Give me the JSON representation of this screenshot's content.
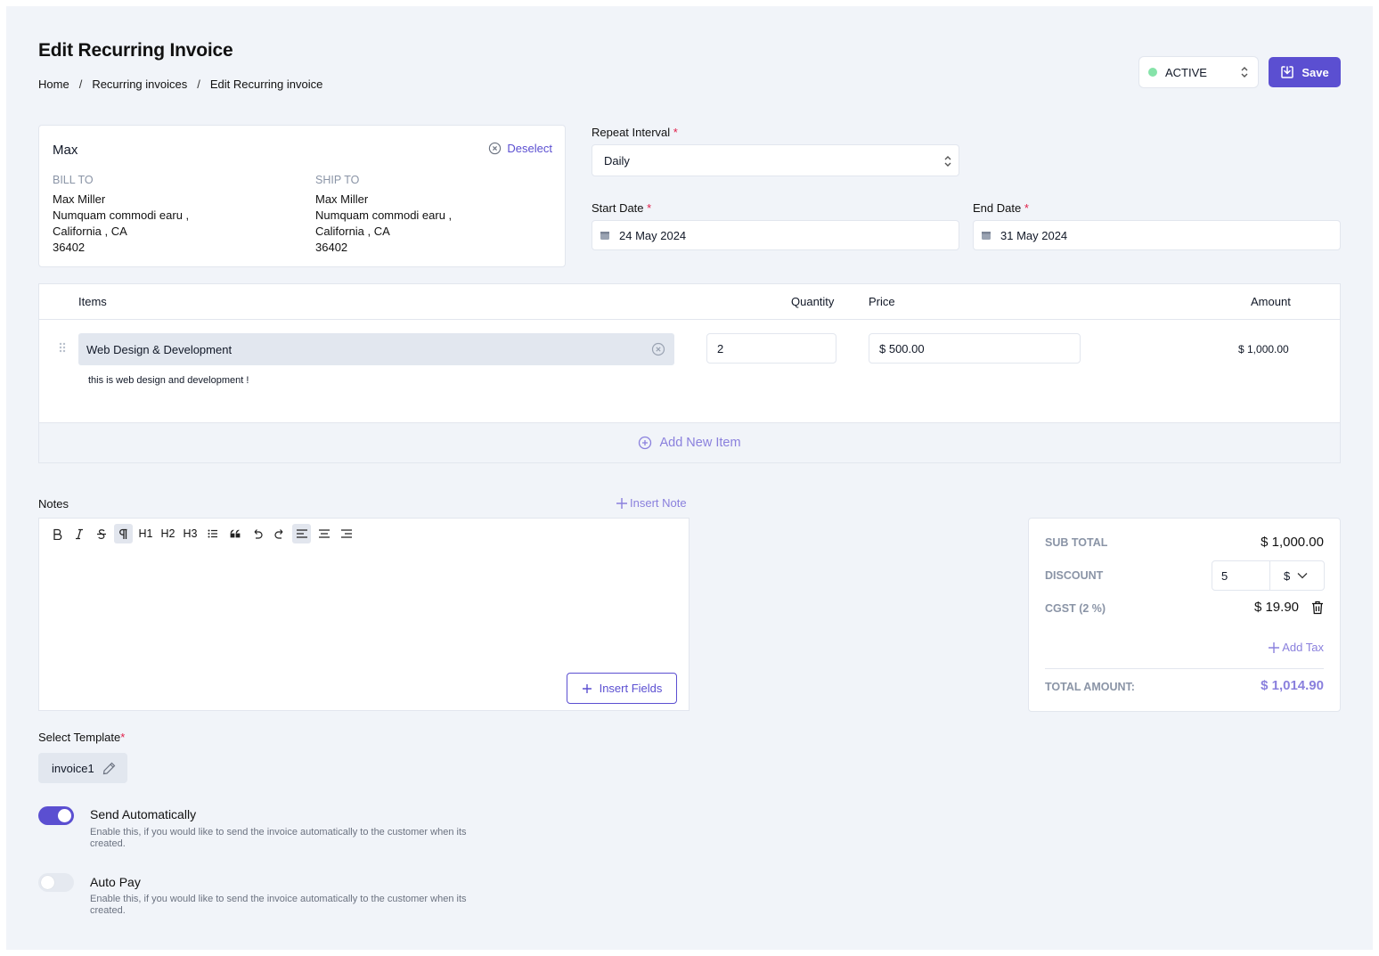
{
  "page": {
    "title": "Edit Recurring Invoice"
  },
  "breadcrumb": [
    "Home",
    "Recurring invoices",
    "Edit Recurring invoice"
  ],
  "status": {
    "value": "ACTIVE",
    "color": "#86e3a9"
  },
  "save_label": "Save",
  "customer": {
    "name": "Max",
    "deselect_label": "Deselect",
    "bill_to": {
      "heading": "BILL TO",
      "lines": [
        "Max Miller",
        "Numquam commodi earu ,",
        "California , CA",
        "36402"
      ]
    },
    "ship_to": {
      "heading": "SHIP TO",
      "lines": [
        "Max Miller",
        "Numquam commodi earu ,",
        "California , CA",
        "36402"
      ]
    }
  },
  "repeat_interval": {
    "label": "Repeat Interval",
    "value": "Daily"
  },
  "start_date": {
    "label": "Start Date",
    "value": "24 May 2024"
  },
  "end_date": {
    "label": "End Date",
    "value": "31 May 2024"
  },
  "items_table": {
    "headers": {
      "items": "Items",
      "quantity": "Quantity",
      "price": "Price",
      "amount": "Amount"
    },
    "rows": [
      {
        "name": "Web Design & Development",
        "description": "this is web design and development !",
        "quantity": "2",
        "price": "$ 500.00",
        "amount": "$ 1,000.00"
      }
    ],
    "add_new_label": "Add New Item"
  },
  "notes": {
    "label": "Notes",
    "insert_note_label": "Insert Note",
    "toolbar": [
      "bold",
      "italic",
      "strikethrough",
      "paragraph",
      "H1",
      "H2",
      "H3",
      "bullet-list",
      "blockquote",
      "undo",
      "redo",
      "align-left",
      "align-center",
      "align-right"
    ],
    "insert_fields_label": "Insert Fields"
  },
  "totals": {
    "sub_total_label": "SUB TOTAL",
    "sub_total": "$ 1,000.00",
    "discount_label": "DISCOUNT",
    "discount_value": "5",
    "discount_type": "$",
    "tax_label": "CGST (2 %)",
    "tax_value": "$ 19.90",
    "add_tax_label": "Add Tax",
    "total_label": "TOTAL AMOUNT:",
    "total_value": "$ 1,014.90"
  },
  "template": {
    "label": "Select Template",
    "value": "invoice1"
  },
  "send_automatically": {
    "title": "Send Automatically",
    "description": "Enable this, if you would like to send the invoice automatically to the customer when its created.",
    "enabled": true
  },
  "auto_pay": {
    "title": "Auto Pay",
    "description": "Enable this, if you would like to send the invoice automatically to the customer when its created.",
    "enabled": false
  },
  "colors": {
    "accent": "#5b4fd1",
    "accent_light": "#8a80dd",
    "background": "#f1f4f9"
  }
}
